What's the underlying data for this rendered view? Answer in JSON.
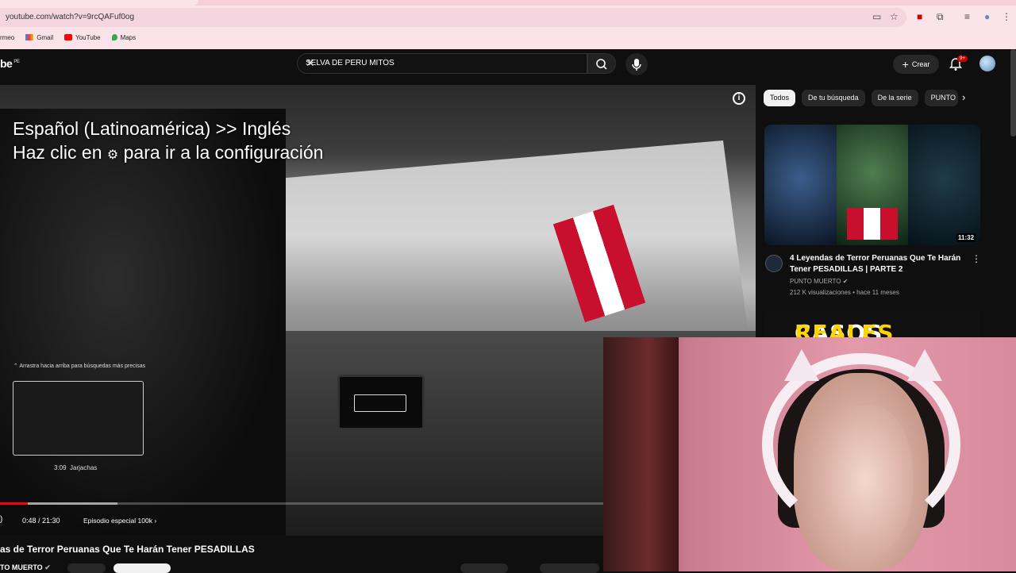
{
  "browser": {
    "url": "youtube.com/watch?v=9rcQAFuf0og",
    "bookmarks": [
      {
        "label": "rmeo",
        "icon": "bookmark-icon"
      },
      {
        "label": "Gmail",
        "icon": "gmail-icon"
      },
      {
        "label": "YouTube",
        "icon": "youtube-icon"
      },
      {
        "label": "Maps",
        "icon": "maps-icon"
      }
    ]
  },
  "header": {
    "logo": "be",
    "country": "PE",
    "search_query": "SELVA DE PERU MITOS",
    "create_label": "Crear",
    "notif_count": "9+"
  },
  "player": {
    "caption_line1": "Español (Latinoamérica) >> Inglés",
    "caption_line2a": "Haz clic en",
    "caption_line2b": "para ir a la configuración",
    "drag_hint": "Arrastra hacia arriba para búsquedas más precisas",
    "preview_time": "3:09",
    "preview_label": "Jarjachas",
    "time_display": "0:48 / 21:30",
    "chapter": "Episodio especial 100k",
    "progress": 0.037
  },
  "video": {
    "title": "as de Terror Peruanas Que Te Harán Tener PESADILLAS",
    "channel": "TO MUERTO"
  },
  "sidebar": {
    "chips": [
      {
        "label": "Todos",
        "active": true
      },
      {
        "label": "De tu búsqueda",
        "active": false
      },
      {
        "label": "De la serie",
        "active": false
      },
      {
        "label": "PUNTO",
        "active": false
      }
    ],
    "videos": [
      {
        "title": "4 Leyendas de Terror Peruanas Que Te Harán Tener PESADILLAS | PARTE 2",
        "channel": "PUNTO MUERTO",
        "meta": "212 K visualizaciones • hace 11 meses",
        "duration": "11:32"
      },
      {
        "thumb_text_white": "CASOS",
        "thumb_text_yellow": "REALES"
      }
    ]
  },
  "colors": {
    "accent": "#ff0000",
    "chrome_bg": "#fbe3ea",
    "yt_bg": "#0f0f0f"
  }
}
